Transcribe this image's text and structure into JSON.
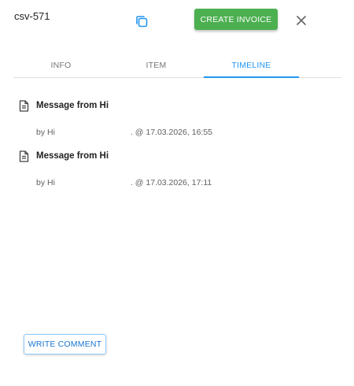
{
  "header": {
    "title": "csv-571",
    "copy_icon": "copy-icon",
    "create_invoice_label": "CREATE INVOICE",
    "close_icon": "close-icon"
  },
  "tabs": [
    {
      "label": "INFO",
      "active": false
    },
    {
      "label": "ITEM",
      "active": false
    },
    {
      "label": "TIMELINE",
      "active": true
    }
  ],
  "timeline": {
    "entries": [
      {
        "icon": "document-icon",
        "title": "Message from Hi",
        "by": "by Hi",
        "timestamp": ". @ 17.03.2026, 16:55"
      },
      {
        "icon": "document-icon",
        "title": "Message from Hi",
        "by": "by Hi",
        "timestamp": ". @ 17.03.2026, 17:11"
      }
    ]
  },
  "footer": {
    "write_comment_label": "WRITE COMMENT"
  },
  "colors": {
    "primary": "#2196f3",
    "success": "#4caf50",
    "outline_border": "#90caf9"
  }
}
